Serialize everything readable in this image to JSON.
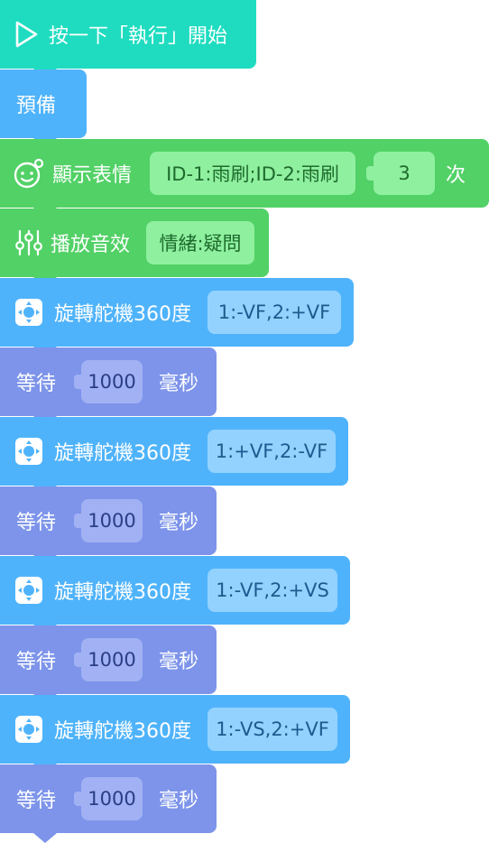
{
  "colors": {
    "event": "#1fdcc0",
    "control": "#4fb3fb",
    "looks": "#52d166",
    "looks_field": "#8ff09f",
    "servo": "#4fb3fb",
    "servo_field": "#93d2ff",
    "wait": "#7d94ea",
    "wait_field": "#a1b1f4",
    "servo_text": "#1d5b8f",
    "looks_text": "#1e6b2d",
    "wait_text": "#2a3d85"
  },
  "blocks": {
    "start": {
      "label": "按一下「執行」開始",
      "icon": "play-outline-icon"
    },
    "prepare": {
      "label": "預備"
    },
    "expression": {
      "label": "顯示表情",
      "value": "ID-1:雨刷;ID-2:雨刷",
      "count": "3",
      "suffix": "次",
      "icon": "smiley-face-icon"
    },
    "sound": {
      "label": "播放音效",
      "value": "情緒:疑問",
      "icon": "sliders-icon"
    },
    "servo1": {
      "label": "旋轉舵機360度",
      "value": "1:-VF,2:+VF",
      "icon": "servo-icon"
    },
    "wait1": {
      "label": "等待",
      "value": "1000",
      "unit": "毫秒"
    },
    "servo2": {
      "label": "旋轉舵機360度",
      "value": "1:+VF,2:-VF",
      "icon": "servo-icon"
    },
    "wait2": {
      "label": "等待",
      "value": "1000",
      "unit": "毫秒"
    },
    "servo3": {
      "label": "旋轉舵機360度",
      "value": "1:-VF,2:+VS",
      "icon": "servo-icon"
    },
    "wait3": {
      "label": "等待",
      "value": "1000",
      "unit": "毫秒"
    },
    "servo4": {
      "label": "旋轉舵機360度",
      "value": "1:-VS,2:+VF",
      "icon": "servo-icon"
    },
    "wait4": {
      "label": "等待",
      "value": "1000",
      "unit": "毫秒"
    }
  }
}
